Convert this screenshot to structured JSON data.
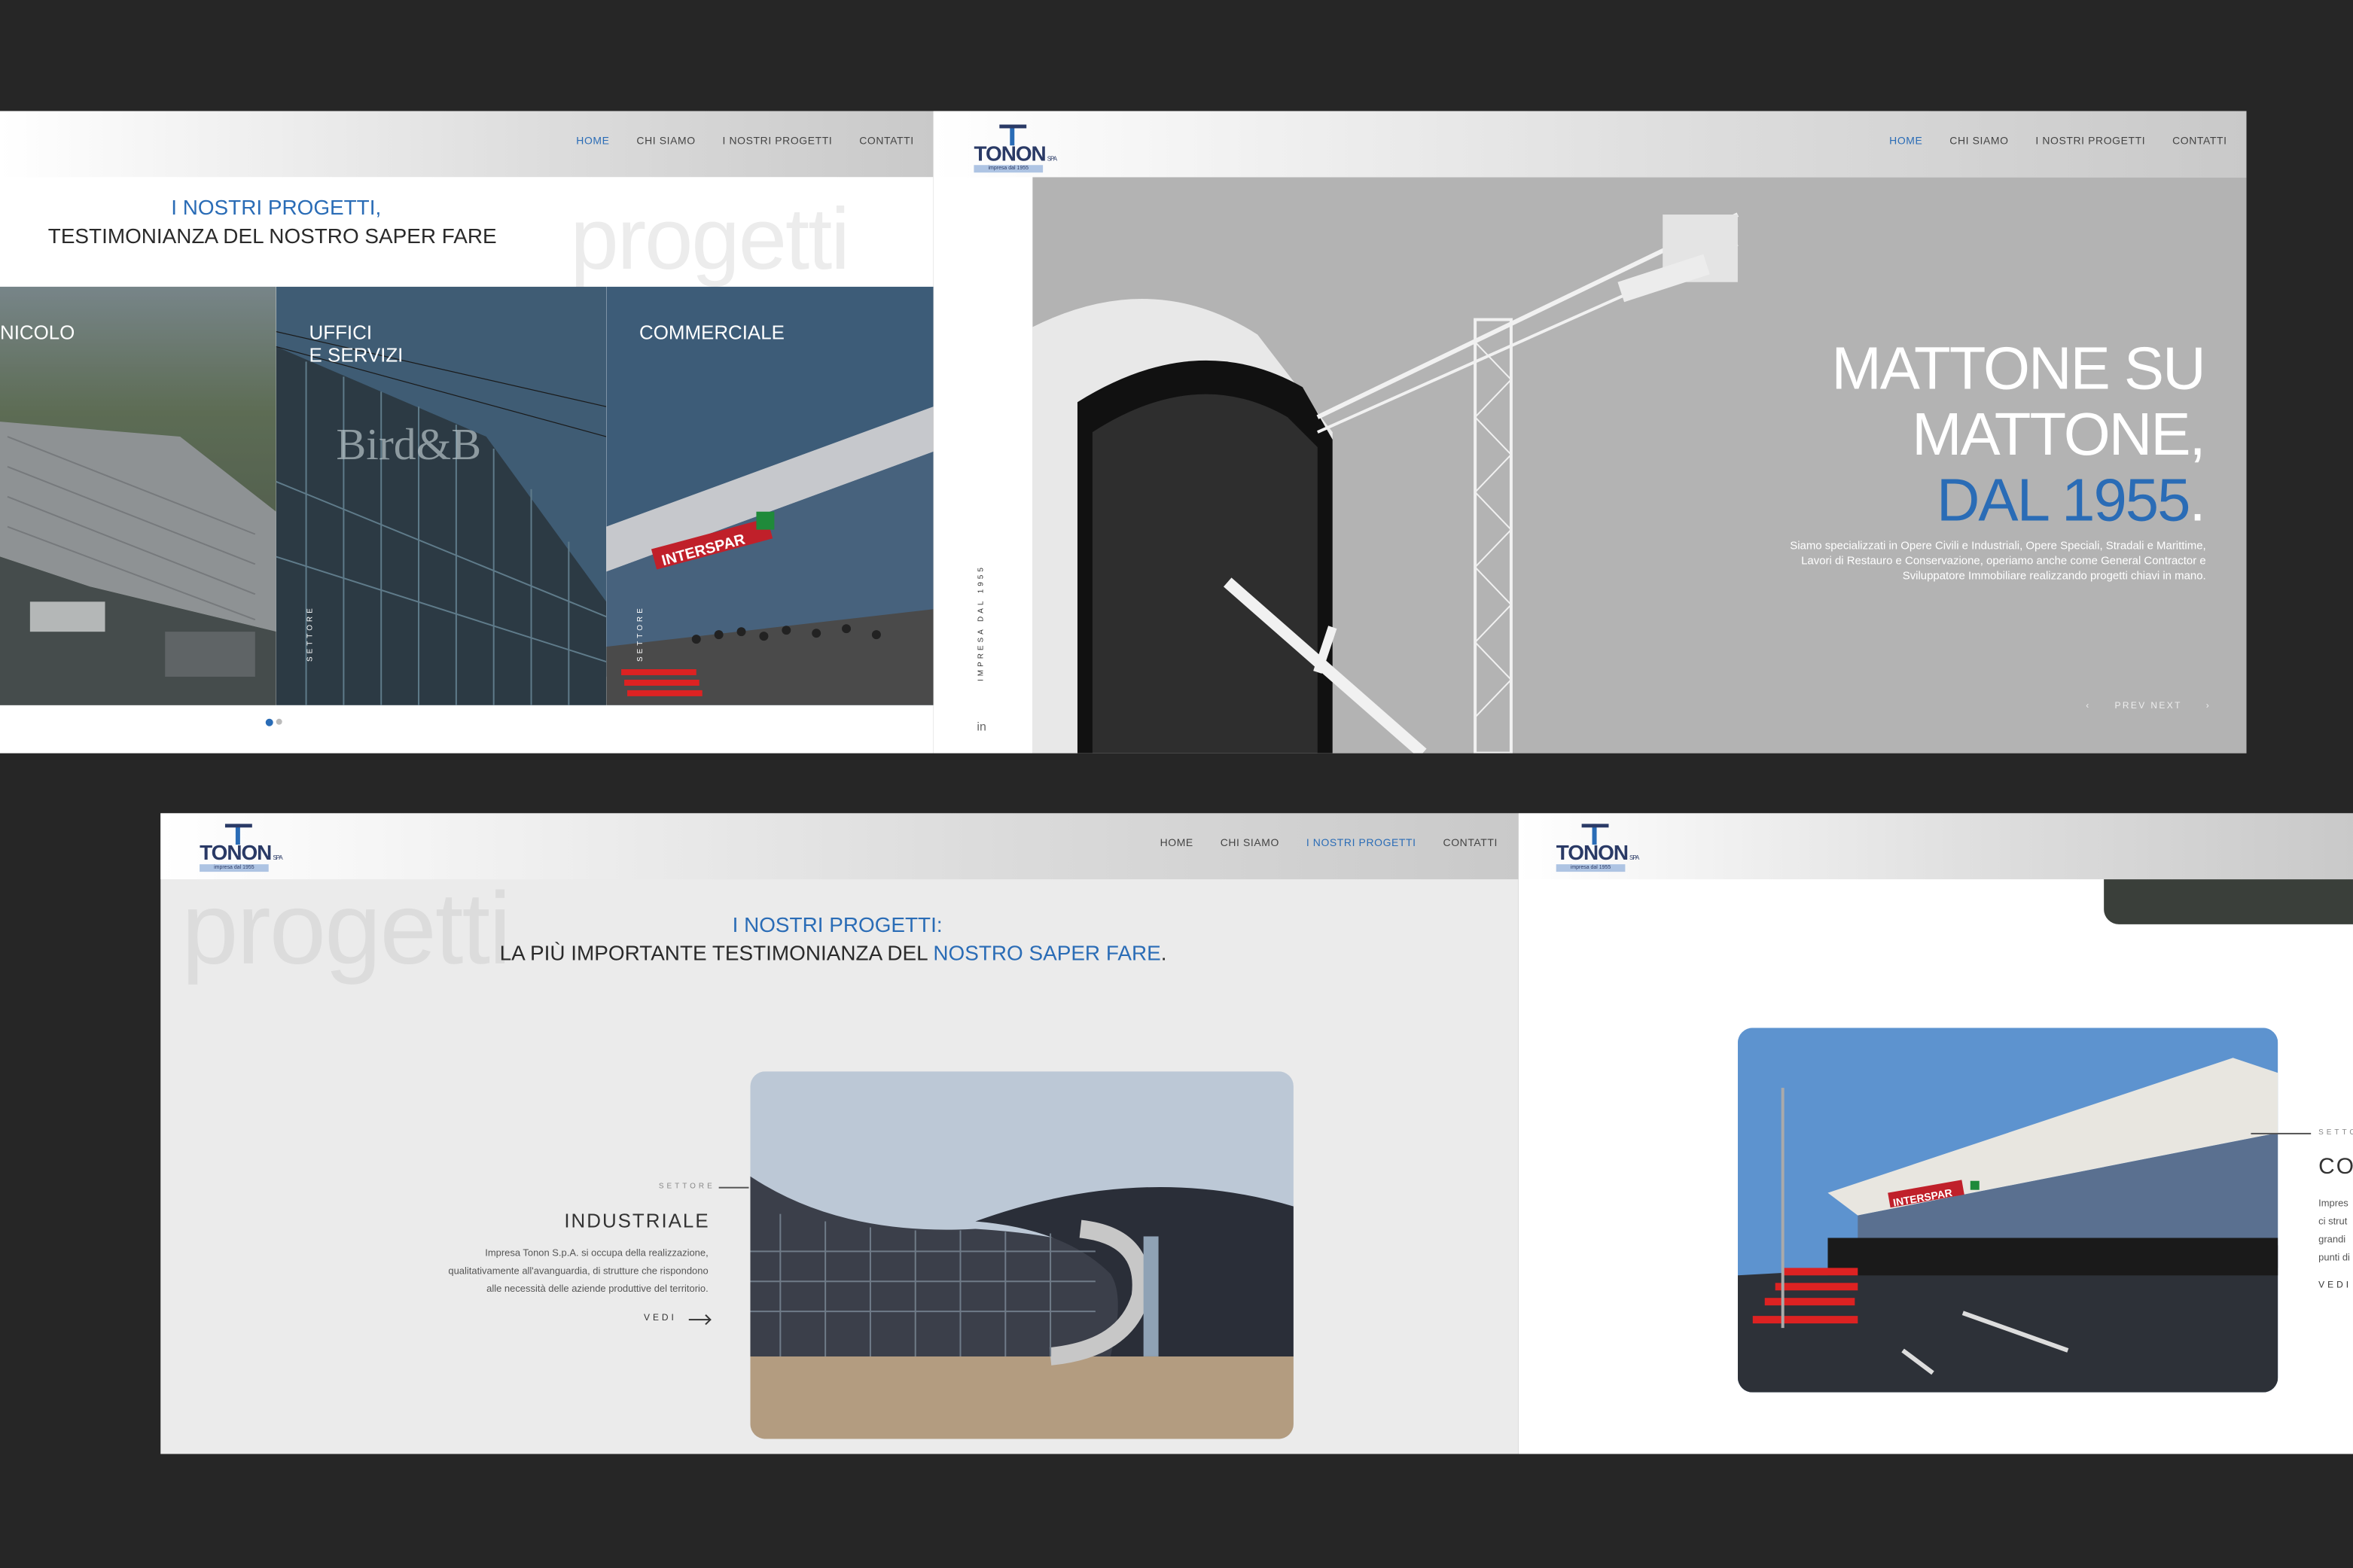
{
  "panel_a": {
    "nav": [
      "HOME",
      "CHI SIAMO",
      "I NOSTRI PROGETTI",
      "CONTATTI"
    ],
    "nav_active": 0,
    "headline_blue": "I NOSTRI PROGETTI,",
    "headline_dark": "TESTIMONIANZA DEL NOSTRO SAPER FARE",
    "watermark": "progetti",
    "cards": [
      {
        "label": "NICOLO",
        "sector": ""
      },
      {
        "label": "UFFICI\nE SERVIZI",
        "sector": "SETTORE"
      },
      {
        "label": "COMMERCIALE",
        "sector": "SETTORE"
      }
    ]
  },
  "panel_b": {
    "logo": {
      "name": "TONON",
      "suffix": "SPA",
      "tagline": "impresa dal 1955"
    },
    "nav": [
      "HOME",
      "CHI SIAMO",
      "I NOSTRI PROGETTI",
      "CONTATTI"
    ],
    "nav_active": 0,
    "side_text": "IMPRESA DAL 1955",
    "social": "in",
    "hero_line1": "MATTONE SU",
    "hero_line2": "MATTONE,",
    "hero_line3": "DAL 1955",
    "hero_dot": ".",
    "hero_desc": "Siamo specializzati in Opere Civili e Industriali, Opere Speciali, Stradali e Marittime, Lavori di Restauro e Conservazione, operiamo anche come General Contractor e Sviluppatore Immobiliare realizzando progetti chiavi in mano.",
    "prev_next": "PREV NEXT"
  },
  "panel_c": {
    "logo": {
      "name": "TONON",
      "suffix": "SPA",
      "tagline": "impresa dal 1955"
    },
    "nav": [
      "HOME",
      "CHI SIAMO",
      "I NOSTRI PROGETTI",
      "CONTATTI"
    ],
    "nav_active": 2,
    "watermark": "progetti",
    "headline_blue": "I NOSTRI PROGETTI:",
    "headline_dark": "LA PIÙ IMPORTANTE TESTIMONIANZA DEL ",
    "headline_tail": "NOSTRO SAPER FARE",
    "headline_end": ".",
    "sector_label": "SETTORE",
    "sector_title": "INDUSTRIALE",
    "sector_desc": "Impresa Tonon S.p.A. si occupa della realizzazione, qualitativamente all'avanguardia, di strutture che rispondono alle necessità delle aziende produttive del territorio.",
    "vedi": "VEDI"
  },
  "panel_d": {
    "logo": {
      "name": "TONON",
      "suffix": "SPA",
      "tagline": "impresa dal 1955"
    },
    "sector_label": "SETTO",
    "sector_title": "CO",
    "desc_lines": [
      "Impres",
      "ci strut",
      "grandi",
      "punti di"
    ],
    "vedi": "VEDI"
  },
  "colors": {
    "accent": "#2a6cb6",
    "background": "#262626"
  }
}
